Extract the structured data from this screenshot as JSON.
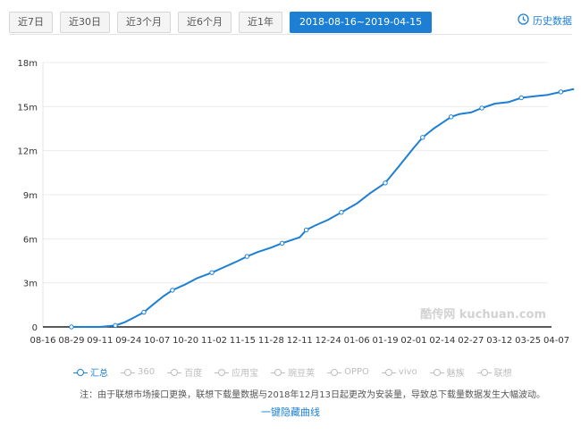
{
  "tabs": [
    {
      "label": "近7日",
      "active": false
    },
    {
      "label": "近30日",
      "active": false
    },
    {
      "label": "近3个月",
      "active": false
    },
    {
      "label": "近6个月",
      "active": false
    },
    {
      "label": "近1年",
      "active": false
    },
    {
      "label": "2018-08-16~2019-04-15",
      "active": true
    }
  ],
  "history_label": "历史数据",
  "watermark": "酷传网 kuchuan.com",
  "legend": [
    {
      "label": "汇总",
      "active": true
    },
    {
      "label": "360",
      "active": false
    },
    {
      "label": "百度",
      "active": false
    },
    {
      "label": "应用宝",
      "active": false
    },
    {
      "label": "豌豆荚",
      "active": false
    },
    {
      "label": "OPPO",
      "active": false
    },
    {
      "label": "vivo",
      "active": false
    },
    {
      "label": "魅族",
      "active": false
    },
    {
      "label": "联想",
      "active": false
    }
  ],
  "note": "注：由于联想市场接口更换，联想下载量数据与2018年12月13日起更改为安装量，导致总下载量数据发生大幅波动。",
  "hide_curves_label": "一键隐藏曲线",
  "colors": {
    "accent": "#1d7fd4",
    "inactive": "#bdbdbd"
  },
  "chart_data": {
    "type": "line",
    "x_ticks": [
      "08-16",
      "08-29",
      "09-11",
      "09-24",
      "10-07",
      "10-20",
      "11-02",
      "11-15",
      "11-28",
      "12-11",
      "12-24",
      "01-06",
      "01-19",
      "02-01",
      "02-14",
      "02-27",
      "03-12",
      "03-25",
      "04-07"
    ],
    "y_ticks": [
      "0",
      "3m",
      "6m",
      "9m",
      "12m",
      "15m",
      "18m"
    ],
    "ylim": [
      0,
      18
    ],
    "y_unit": "m",
    "grid": "horizontal",
    "series": [
      {
        "name": "汇总",
        "x": [
          "2018-08-29",
          "2018-09-06",
          "2018-09-11",
          "2018-09-18",
          "2018-09-22",
          "2018-09-26",
          "2018-10-01",
          "2018-10-05",
          "2018-10-10",
          "2018-10-14",
          "2018-10-20",
          "2018-10-25",
          "2018-11-01",
          "2018-11-07",
          "2018-11-13",
          "2018-11-17",
          "2018-11-22",
          "2018-11-28",
          "2018-12-03",
          "2018-12-09",
          "2018-12-11",
          "2018-12-14",
          "2018-12-18",
          "2018-12-24",
          "2018-12-30",
          "2019-01-06",
          "2019-01-12",
          "2019-01-19",
          "2019-01-25",
          "2019-02-01",
          "2019-02-05",
          "2019-02-10",
          "2019-02-14",
          "2019-02-18",
          "2019-02-22",
          "2019-02-27",
          "2019-03-04",
          "2019-03-10",
          "2019-03-16",
          "2019-03-22",
          "2019-03-28",
          "2019-04-03",
          "2019-04-09",
          "2019-04-15"
        ],
        "y": [
          0.0,
          0.0,
          0.0,
          0.1,
          0.3,
          0.6,
          1.0,
          1.5,
          2.1,
          2.5,
          2.9,
          3.3,
          3.7,
          4.1,
          4.5,
          4.8,
          5.1,
          5.4,
          5.7,
          6.0,
          6.1,
          6.6,
          6.9,
          7.3,
          7.8,
          8.4,
          9.1,
          9.8,
          10.9,
          12.2,
          12.9,
          13.5,
          13.9,
          14.3,
          14.5,
          14.6,
          14.9,
          15.2,
          15.3,
          15.6,
          15.7,
          15.8,
          16.0,
          16.2
        ]
      }
    ]
  }
}
